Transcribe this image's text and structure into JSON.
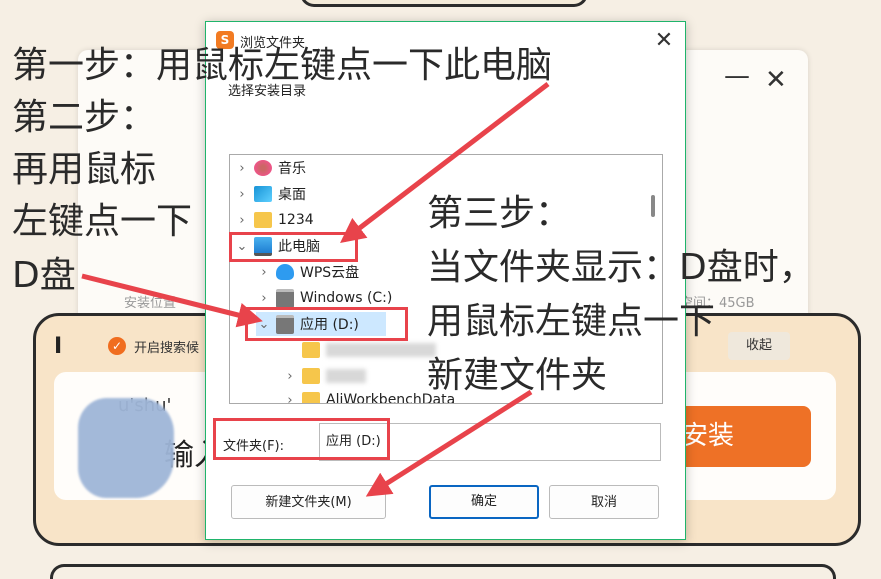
{
  "background": {
    "location_label": "安装位置",
    "space_label": "空间：45GB",
    "panel_icon_text": "I",
    "search_option": "开启搜索候",
    "collapse_label": "收起",
    "pinyin_hint": "u'shu'",
    "input_text": "输入",
    "install_label": "安装"
  },
  "dialog": {
    "title": "浏览文件夹",
    "prompt": "选择安装目录",
    "tree": [
      {
        "label": "音乐",
        "icon": "music-icon"
      },
      {
        "label": "桌面",
        "icon": "desktop-icon"
      },
      {
        "label": "1234",
        "icon": "folder-icon"
      },
      {
        "label": "此电脑",
        "icon": "computer-icon"
      },
      {
        "label": "WPS云盘",
        "icon": "cloud-icon"
      },
      {
        "label": "Windows (C:)",
        "icon": "drive-icon"
      },
      {
        "label": "应用 (D:)",
        "icon": "drive-icon"
      },
      {
        "label": "AliWorkbenchData",
        "icon": "folder-icon"
      }
    ],
    "folder_label": "文件夹(F):",
    "folder_value": "应用 (D:)",
    "new_folder_button": "新建文件夹(M)",
    "ok_button": "确定",
    "cancel_button": "取消"
  },
  "annotations": {
    "step1": "第一步：用鼠标左键点一下此电脑",
    "step2_line1": "第二步：",
    "step2_line2": "再用鼠标",
    "step2_line3": "左键点一下",
    "step2_line4": "D盘",
    "step3_line1": "第三步：",
    "step3_line2": "当文件夹显示：D盘时，",
    "step3_line3": "用鼠标左键点一下",
    "step3_line4": "新建文件夹"
  },
  "colors": {
    "accent_orange": "#ee7126",
    "annotation_red": "#e8434b",
    "dialog_border": "#1fb46b"
  }
}
